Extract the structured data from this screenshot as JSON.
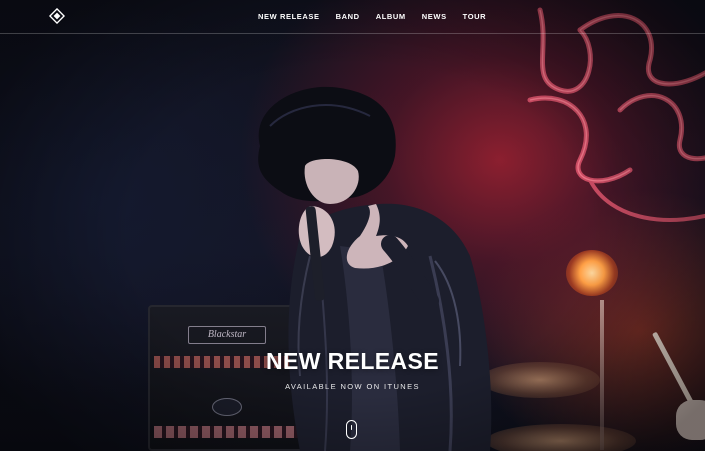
{
  "brand": {
    "logo_icon": "diamond-logo-icon"
  },
  "nav": {
    "items": [
      {
        "label": "NEW RELEASE"
      },
      {
        "label": "BAND"
      },
      {
        "label": "ALBUM"
      },
      {
        "label": "NEWS"
      },
      {
        "label": "TOUR"
      }
    ]
  },
  "hero": {
    "title": "NEW RELEASE",
    "subtitle": "AVAILABLE NOW ON ITUNES",
    "scroll_icon": "mouse-scroll-icon",
    "amp_brand": "Blackstar",
    "colors": {
      "accent_red": "#b0203a",
      "text": "#ffffff"
    }
  }
}
